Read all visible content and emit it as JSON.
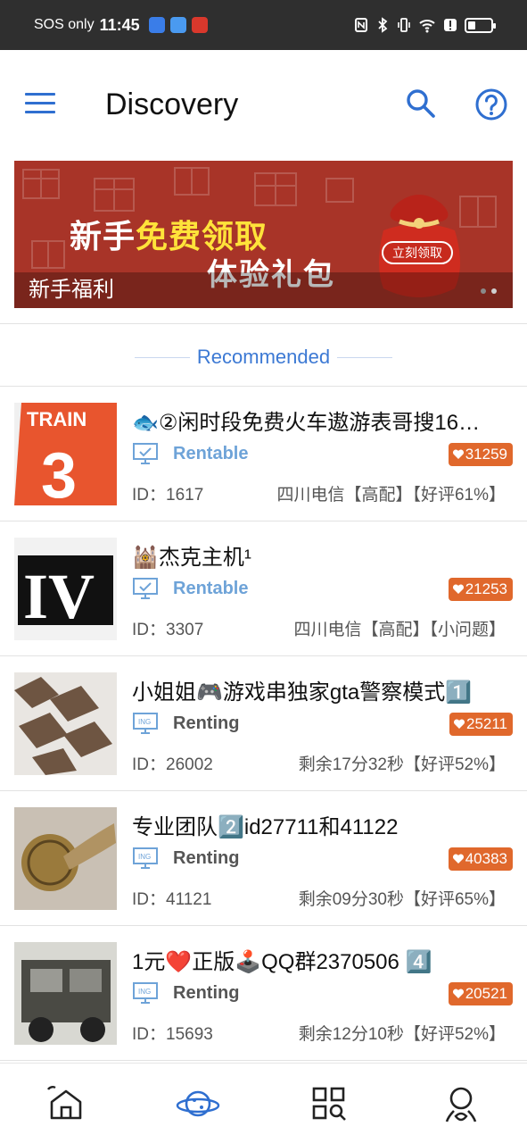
{
  "status_bar": {
    "carrier": "SOS only",
    "time": "11:45"
  },
  "header": {
    "title": "Discovery"
  },
  "banner": {
    "line1_prefix": "新手",
    "line1_highlight": "免费领取",
    "line2": "体验礼包",
    "caption": "新手福利",
    "bag_button": "立刻领取"
  },
  "section": {
    "label": "Recommended"
  },
  "items": [
    {
      "title": "🐟②闲时段免费火车遨游表哥搜16…",
      "status": "Rentable",
      "likes": "31259",
      "id": "ID：1617",
      "info": "四川电信【高配】【好评61%】"
    },
    {
      "title": "🕍杰克主机¹",
      "status": "Rentable",
      "likes": "21253",
      "id": "ID：3307",
      "info": "四川电信【高配】【小问题】"
    },
    {
      "title": "小姐姐🎮游戏串独家gta警察模式1️⃣",
      "status": "Renting",
      "likes": "25211",
      "id": "ID：26002",
      "info": "剩余17分32秒【好评52%】"
    },
    {
      "title": "专业团队2️⃣id27711和41122",
      "status": "Renting",
      "likes": "40383",
      "id": "ID：41121",
      "info": "剩余09分30秒【好评65%】"
    },
    {
      "title": "1元❤️正版🕹️QQ群2370506 4️⃣",
      "status": "Renting",
      "likes": "20521",
      "id": "ID：15693",
      "info": "剩余12分10秒【好评52%】"
    }
  ],
  "colors": {
    "accent": "#2f6fd0",
    "badge": "#e0682c",
    "banner_bg": "#a83428"
  }
}
